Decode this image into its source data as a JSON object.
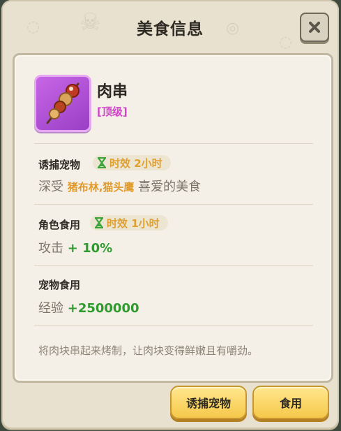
{
  "dialog": {
    "title": "美食信息",
    "close_icon": "close-icon"
  },
  "item": {
    "name": "肉串",
    "grade": "[顶级]",
    "icon": "meat-skewer-icon"
  },
  "sections": [
    {
      "title": "诱捕宠物",
      "timer": "时效 2小时",
      "prefix": "深受",
      "highlight": "猪布林,猫头鹰",
      "suffix": "喜爱的美食"
    },
    {
      "title": "角色食用",
      "timer": "时效 1小时",
      "stat_label": "攻击",
      "stat_value": "+ 10%"
    },
    {
      "title": "宠物食用",
      "stat_label": "经验",
      "stat_value": "+2500000"
    }
  ],
  "description": "将肉块串起来烤制，让肉块变得鲜嫩且有嚼劲。",
  "buttons": {
    "lure": "诱捕宠物",
    "eat": "食用"
  },
  "colors": {
    "grade": "#d144c9",
    "highlight": "#e09a2b",
    "positive": "#2f9a2f",
    "button": "#f6c84a"
  }
}
